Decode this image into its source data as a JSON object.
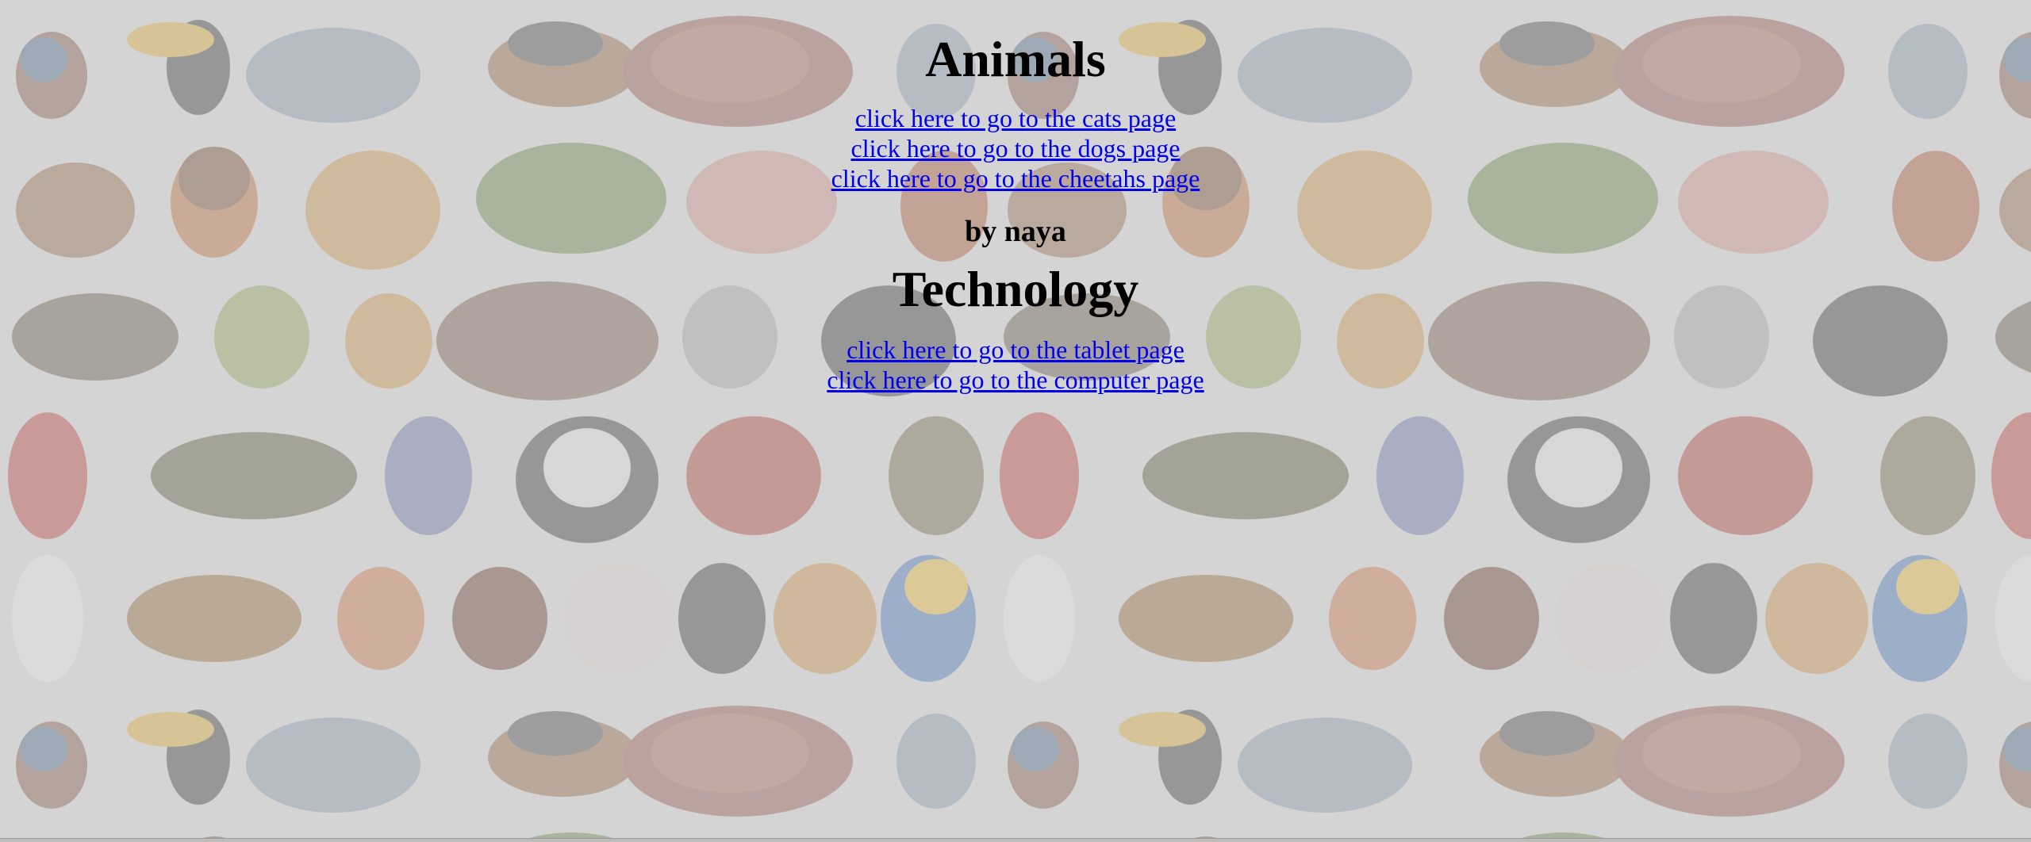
{
  "sections": {
    "animals": {
      "heading": "Animals",
      "links": {
        "cats": "click here to go to the cats page",
        "dogs": "click here to go to the dogs page",
        "cheetahs": "click here to go to the cheetahs page"
      },
      "byline": "by naya"
    },
    "technology": {
      "heading": "Technology",
      "links": {
        "tablet": "click here to go to the tablet page",
        "computer": "click here to go to the computer page"
      }
    }
  },
  "colors": {
    "background": "#d4d4d4",
    "link": "#0000ee",
    "heading": "#000000"
  },
  "background_pattern": [
    "toucan",
    "rhino",
    "jackal",
    "turtle",
    "snail",
    "lion",
    "cheetah",
    "tortoise",
    "pig",
    "rooster",
    "mantis",
    "beaver",
    "rabbit",
    "swan",
    "parrot",
    "crocodile",
    "panda",
    "ladybug",
    "kangaroo",
    "duck",
    "tiger",
    "hen",
    "horse",
    "ram",
    "sheep",
    "dog",
    "macaw"
  ]
}
